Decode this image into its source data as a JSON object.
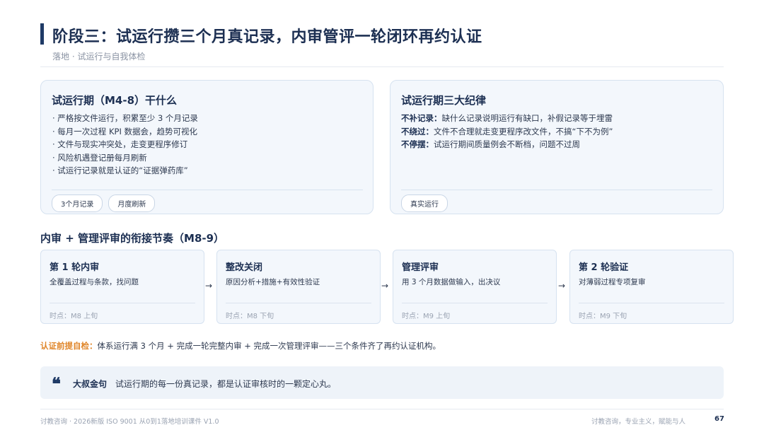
{
  "header": {
    "title": "阶段三：试运行攒三个月真记录，内审管评一轮闭环再约认证",
    "subtitle": "落地 · 试运行与自我体检"
  },
  "card_left": {
    "title": "试运行期（M4-8）干什么",
    "bullets": [
      "· 严格按文件运行，积累至少 3 个月记录",
      "· 每月一次过程 KPI 数据会，趋势可视化",
      "· 文件与现实冲突处，走变更程序修订",
      "· 风险机遇登记册每月刷新",
      "· 试运行记录就是认证的“证据弹药库”"
    ],
    "tags": [
      "3个月记录",
      "月度刷新"
    ]
  },
  "card_right": {
    "title": "试运行期三大纪律",
    "rules": [
      {
        "key": "不补记录：",
        "text": "缺什么记录说明运行有缺口，补假记录等于埋雷"
      },
      {
        "key": "不绕过：",
        "text": "文件不合理就走变更程序改文件，不搞“下不为例”"
      },
      {
        "key": "不停摆：",
        "text": "试运行期间质量例会不断档，问题不过周"
      }
    ],
    "tags": [
      "真实运行"
    ]
  },
  "section": {
    "title": "内审 + 管理评审的衔接节奏（M8-9）"
  },
  "steps": [
    {
      "title": "第 1 轮内审",
      "desc": "全覆盖过程与条款，找问题",
      "time": "时点：M8 上旬"
    },
    {
      "title": "整改关闭",
      "desc": "原因分析+措施+有效性验证",
      "time": "时点：M8 下旬"
    },
    {
      "title": "管理评审",
      "desc": "用 3 个月数据做输入，出决议",
      "time": "时点：M9 上旬"
    },
    {
      "title": "第 2 轮验证",
      "desc": "对薄弱过程专项复审",
      "time": "时点：M9 下旬"
    }
  ],
  "arrow_glyph": "→",
  "precondition": {
    "label": "认证前提自检：",
    "text": "体系运行满 3 个月 + 完成一轮完整内审 + 完成一次管理评审——三个条件齐了再约认证机构。"
  },
  "quote": {
    "icon": "quote-icon",
    "glyph": "❝",
    "label": "大叔金句",
    "text": "试运行期的每一份真记录，都是认证审核时的一颗定心丸。"
  },
  "footer": {
    "left": "讨教咨询 · 2026新版 ISO 9001 从0到1落地培训课件 V1.0",
    "right": "讨教咨询，专业主义，赋能与人",
    "page": "67"
  },
  "colors": {
    "accent": "#1f3a66",
    "highlight": "#e0862a",
    "card_bg": "#f3f7fc"
  }
}
